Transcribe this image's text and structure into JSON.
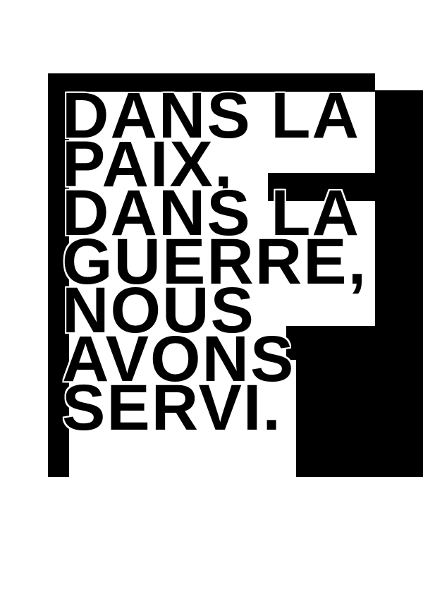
{
  "poster": {
    "lines": [
      "DANS LA",
      "PAIX,",
      "DANS LA",
      "GUERRE,",
      "NOUS",
      "AVONS",
      "SERVI."
    ],
    "colors": {
      "background": "#ffffff",
      "ink": "#000000"
    }
  }
}
